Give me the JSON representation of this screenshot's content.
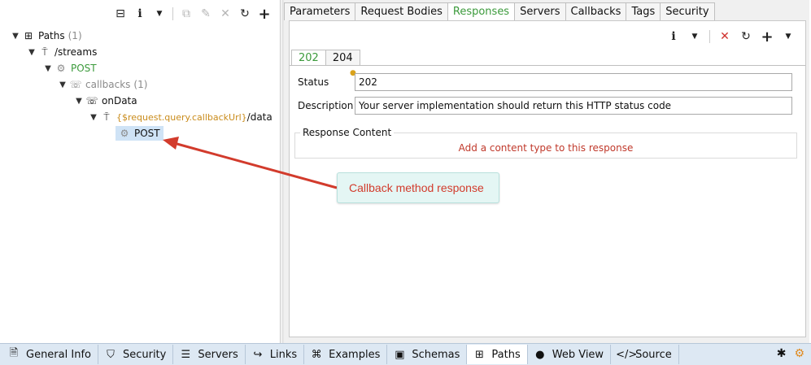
{
  "left_toolbar": {
    "icons": [
      "collapse-icon",
      "info-icon",
      "dropdown-icon",
      "copy-icon",
      "edit-icon",
      "delete-icon",
      "refresh-icon",
      "add-icon"
    ]
  },
  "tree": {
    "paths_label": "Paths",
    "paths_count": "(1)",
    "streams_label": "/streams",
    "post_label": "POST",
    "callbacks_label": "callbacks",
    "callbacks_count": "(1)",
    "ondata_label": "onData",
    "callback_url_expr": "{$request.query.callbackUrl}",
    "callback_url_suffix": "/data",
    "callback_post_label": "POST"
  },
  "top_tabs": [
    "Parameters",
    "Request Bodies",
    "Responses",
    "Servers",
    "Callbacks",
    "Tags",
    "Security"
  ],
  "active_top_tab": "Responses",
  "response_tabs": [
    "202",
    "204"
  ],
  "active_response_tab": "202",
  "form": {
    "status_label": "Status",
    "status_value": "202",
    "description_label": "Description",
    "description_value": "Your server implementation should return this HTTP status code",
    "response_content_label": "Response Content",
    "add_content_link": "Add a content type to this response"
  },
  "callout": {
    "text": "Callback method response"
  },
  "bottom_tabs": [
    {
      "label": "General Info",
      "icon": "document-icon"
    },
    {
      "label": "Security",
      "icon": "shield-icon"
    },
    {
      "label": "Servers",
      "icon": "server-icon"
    },
    {
      "label": "Links",
      "icon": "link-icon"
    },
    {
      "label": "Examples",
      "icon": "examples-icon"
    },
    {
      "label": "Schemas",
      "icon": "schemas-icon"
    },
    {
      "label": "Paths",
      "icon": "paths-icon"
    },
    {
      "label": "Web View",
      "icon": "globe-icon"
    },
    {
      "label": "Source",
      "icon": "code-icon"
    }
  ],
  "active_bottom_tab": "Paths",
  "colors": {
    "accent_green": "#3b9a3b",
    "link_red": "#c0392b",
    "callout_text": "#d23b2c",
    "callout_bg": "#e4f6f4",
    "selection_bg": "#cfe3f6"
  }
}
